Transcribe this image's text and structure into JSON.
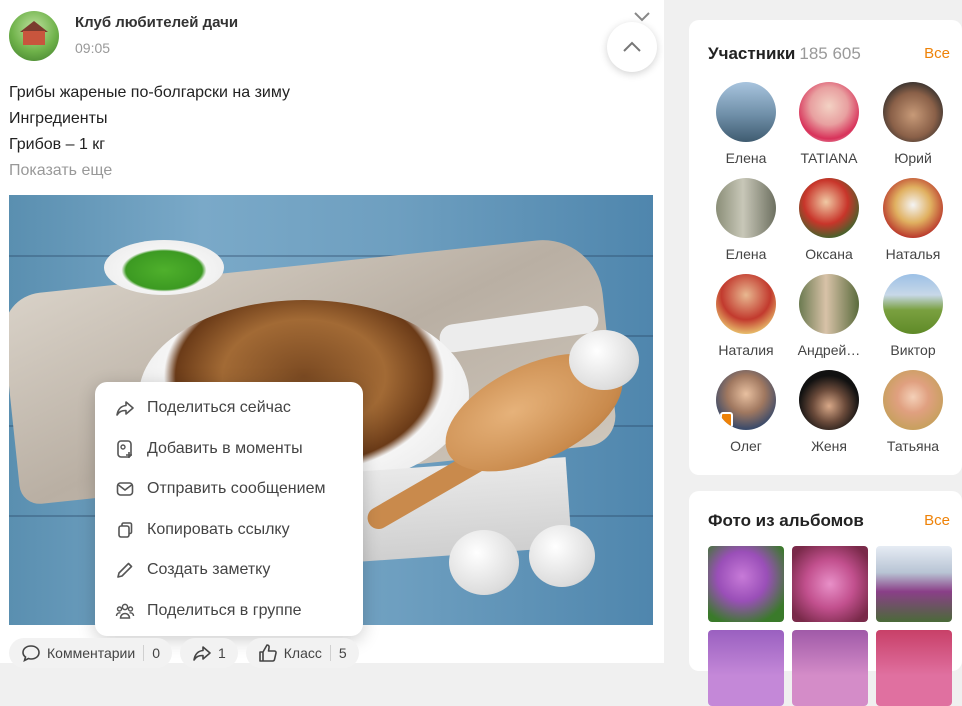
{
  "post": {
    "group_name": "Клуб любителей дачи",
    "time": "09:05",
    "text_lines": [
      "Грибы жареные по-болгарски на зиму",
      "Ингредиенты",
      "Грибов – 1 кг"
    ],
    "show_more": "Показать еще"
  },
  "share_menu": {
    "items": [
      {
        "label": "Поделиться сейчас",
        "icon": "share-arrow-icon"
      },
      {
        "label": "Добавить в моменты",
        "icon": "moments-add-icon"
      },
      {
        "label": "Отправить сообщением",
        "icon": "envelope-icon"
      },
      {
        "label": "Копировать ссылку",
        "icon": "copy-icon"
      },
      {
        "label": "Создать заметку",
        "icon": "pencil-icon"
      },
      {
        "label": "Поделиться в группе",
        "icon": "group-icon"
      }
    ]
  },
  "actions": {
    "comments_label": "Комментарии",
    "comments_count": "0",
    "shares_count": "1",
    "likes_label": "Класс",
    "likes_count": "5"
  },
  "members": {
    "title": "Участники",
    "count": "185 605",
    "all_label": "Все",
    "list": [
      {
        "name": "Елена",
        "online": false
      },
      {
        "name": "TATIANA",
        "online": false
      },
      {
        "name": "Юрий",
        "online": false
      },
      {
        "name": "Елена",
        "online": false
      },
      {
        "name": "Оксана",
        "online": false
      },
      {
        "name": "Наталья",
        "online": false
      },
      {
        "name": "Наталия",
        "online": false
      },
      {
        "name": "Андрей…",
        "online": false
      },
      {
        "name": "Виктор",
        "online": false
      },
      {
        "name": "Олег",
        "online": true
      },
      {
        "name": "Женя",
        "online": false
      },
      {
        "name": "Татьяна",
        "online": false
      }
    ]
  },
  "albums": {
    "title": "Фото из альбомов",
    "all_label": "Все"
  },
  "colors": {
    "accent": "#ee8208",
    "muted_text": "#999999",
    "card_bg": "#ffffff",
    "page_bg": "#f0f0f0"
  }
}
